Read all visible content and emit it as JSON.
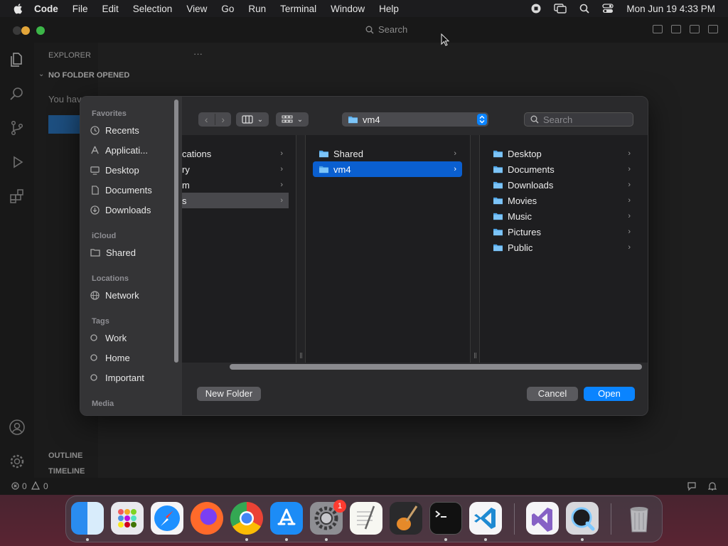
{
  "menubar": {
    "app": "Code",
    "items": [
      "File",
      "Edit",
      "Selection",
      "View",
      "Go",
      "Run",
      "Terminal",
      "Window",
      "Help"
    ],
    "datetime": "Mon Jun 19  4:33 PM"
  },
  "vscode": {
    "search_label": "Search",
    "explorer_title": "EXPLORER",
    "no_folder": "NO FOLDER OPENED",
    "truncated_text": "You hav",
    "outline": "OUTLINE",
    "timeline": "TIMELINE",
    "status_errors": "0",
    "status_warnings": "0"
  },
  "dialog": {
    "path_label": "vm4",
    "search_placeholder": "Search",
    "sidebar": {
      "favorites_heading": "Favorites",
      "favorites": [
        {
          "label": "Recents",
          "icon": "clock-icon"
        },
        {
          "label": "Applicati...",
          "icon": "applications-icon"
        },
        {
          "label": "Desktop",
          "icon": "desktop-icon"
        },
        {
          "label": "Documents",
          "icon": "document-icon"
        },
        {
          "label": "Downloads",
          "icon": "download-icon"
        }
      ],
      "icloud_heading": "iCloud",
      "icloud": [
        {
          "label": "Shared",
          "icon": "shared-folder-icon"
        }
      ],
      "locations_heading": "Locations",
      "locations": [
        {
          "label": "Network",
          "icon": "globe-icon"
        }
      ],
      "tags_heading": "Tags",
      "tags": [
        {
          "label": "Work"
        },
        {
          "label": "Home"
        },
        {
          "label": "Important"
        }
      ],
      "media_heading": "Media"
    },
    "columns": {
      "col1": [
        "cations",
        "ry",
        "m",
        "s"
      ],
      "col2": [
        "Shared",
        "vm4"
      ],
      "col3": [
        "Desktop",
        "Documents",
        "Downloads",
        "Movies",
        "Music",
        "Pictures",
        "Public"
      ]
    },
    "buttons": {
      "new_folder": "New Folder",
      "cancel": "Cancel",
      "open": "Open"
    }
  },
  "dock": {
    "apps": [
      "Finder",
      "Launchpad",
      "Safari",
      "Firefox",
      "Chrome",
      "App Store",
      "System Settings",
      "TextEdit",
      "GarageBand",
      "Terminal",
      "Visual Studio Code",
      "Visual Studio",
      "QuickTime Player",
      "Trash"
    ],
    "settings_badge": "1"
  },
  "colors": {
    "accent": "#0a84ff",
    "selection": "#0a5fd0",
    "badge": "#ff3b30"
  }
}
